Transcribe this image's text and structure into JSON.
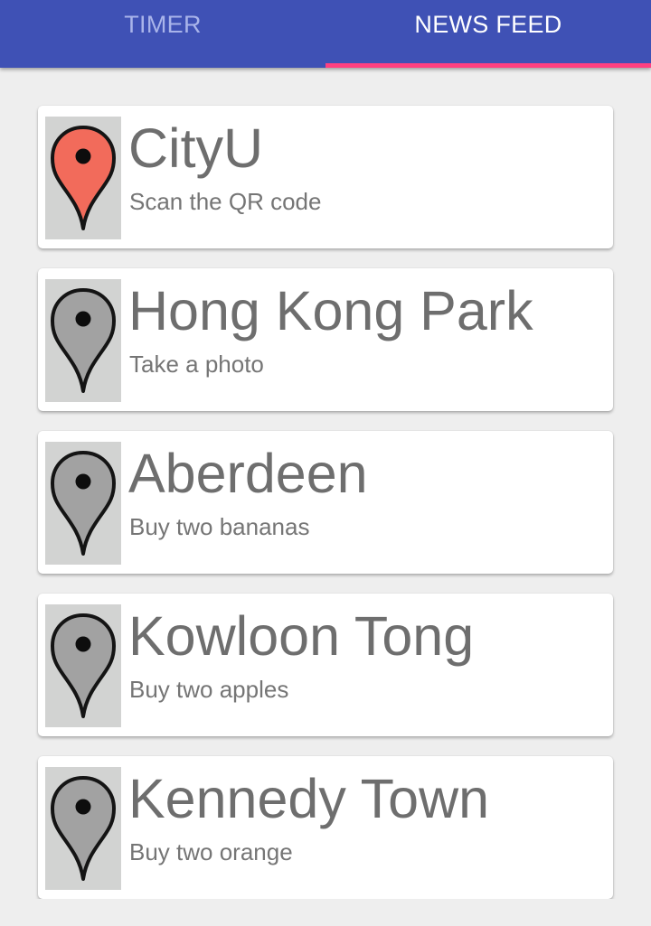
{
  "tabs": {
    "timer_label": "TIMER",
    "news_label": "NEWS FEED",
    "selected": "NEWS FEED",
    "bar_color": "#3f51b5",
    "indicator_color": "#ff4081"
  },
  "locations": [
    {
      "title": "CityU",
      "task": "Scan the QR code",
      "icon": "map-pin-icon",
      "pin_color": "#f26b5b"
    },
    {
      "title": "Hong Kong Park",
      "task": "Take a photo",
      "icon": "map-pin-icon",
      "pin_color": "#a2a2a2"
    },
    {
      "title": "Aberdeen",
      "task": "Buy two bananas",
      "icon": "map-pin-icon",
      "pin_color": "#a2a2a2"
    },
    {
      "title": "Kowloon Tong",
      "task": "Buy two apples",
      "icon": "map-pin-icon",
      "pin_color": "#a2a2a2"
    },
    {
      "title": "Kennedy Town",
      "task": "Buy two orange",
      "icon": "map-pin-icon",
      "pin_color": "#a2a2a2"
    }
  ]
}
